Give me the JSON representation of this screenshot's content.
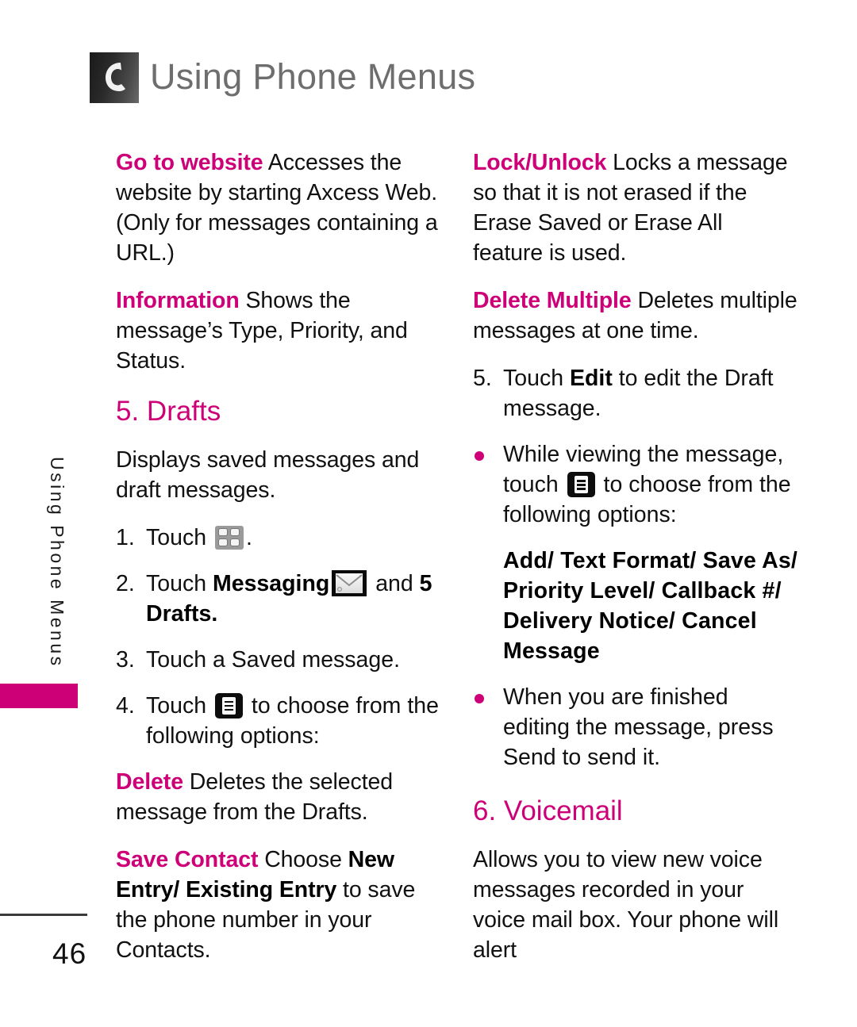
{
  "header": {
    "title": "Using Phone Menus",
    "icon": "phone-handset-icon"
  },
  "sidebar": {
    "vertical_label": "Using Phone Menus",
    "tab_color": "#ce0078"
  },
  "theme": {
    "accent": "#ce0078",
    "header_gray": "#6e6e6e",
    "body_text": "#111111"
  },
  "left_column": {
    "entries": [
      {
        "term": "Go to website",
        "text": " Accesses the website by starting Axcess Web. (Only for messages containing a URL.)"
      },
      {
        "term": "Information",
        "text": " Shows the message’s Type, Priority, and Status."
      }
    ],
    "section": {
      "heading": "5. Drafts",
      "intro": "Displays saved messages and draft messages.",
      "steps": [
        {
          "num": "1.",
          "pre": "Touch ",
          "icon": "grid-menu-icon",
          "post": "."
        },
        {
          "num": "2.",
          "pre": "Touch ",
          "bold": "Messaging",
          "icon": "envelope-icon",
          "mid": " and ",
          "bold2": "5 Drafts",
          "post": "."
        },
        {
          "num": "3.",
          "pre": "Touch a Saved message.",
          "icon": "",
          "post": ""
        },
        {
          "num": "4.",
          "pre": "Touch ",
          "icon": "options-list-icon",
          "post": " to choose from the following options:"
        }
      ],
      "options": [
        {
          "term": "Delete",
          "text": " Deletes the selected message from the Drafts."
        },
        {
          "term": "Save Contact",
          "text_before_bold": " Choose ",
          "bold": "New Entry/ Existing Entry",
          "text_after_bold": " to save the phone number in your Contacts."
        }
      ]
    }
  },
  "right_column": {
    "entries": [
      {
        "term": "Lock/Unlock",
        "text": " Locks a message so that it is not erased if the Erase Saved or Erase All feature is used."
      },
      {
        "term": "Delete Multiple",
        "text": " Deletes multiple messages at one time."
      }
    ],
    "step5": {
      "num": "5.",
      "pre": "Touch ",
      "bold": "Edit",
      "post": " to edit the Draft message."
    },
    "bullet1": {
      "pre": "While viewing the message, touch ",
      "icon": "options-list-icon",
      "post": " to choose from the following options:"
    },
    "options_bold": "Add/ Text Format/ Save As/ Priority Level/ Callback #/ Delivery Notice/ Cancel Message",
    "bullet2": "When you are finished editing the message, press Send to send it.",
    "section": {
      "heading": "6. Voicemail",
      "body": "Allows you to view new voice messages recorded in your voice mail box. Your phone will alert"
    }
  },
  "footer": {
    "page_number": "46"
  }
}
